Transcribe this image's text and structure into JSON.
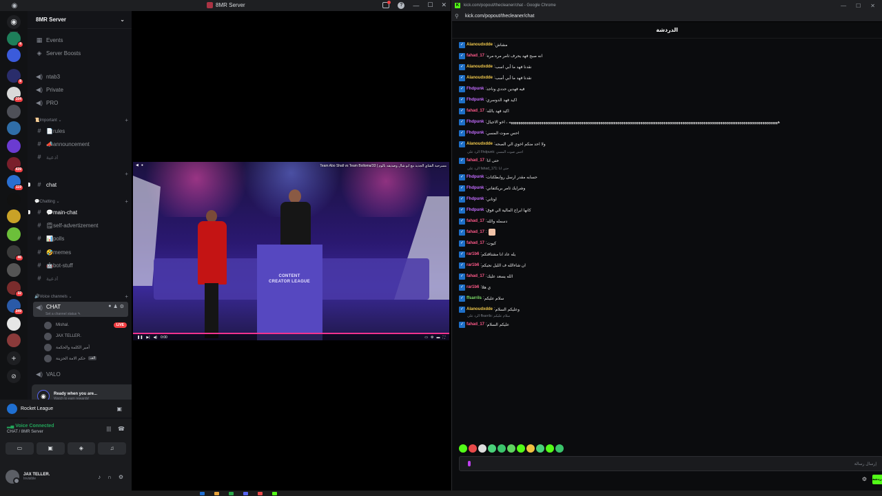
{
  "discord": {
    "window_title": "8MR Server",
    "server_name": "8MR Server",
    "channels": {
      "events": "Events",
      "boosts": "Server Boosts",
      "ntab3": "ntab3",
      "private": "Private",
      "pro": "PRO",
      "cat_important": "📜Important ⌄",
      "rules": "📄rules",
      "announcement": "📣announcement",
      "dim1": "ادعية",
      "chat": "chat",
      "cat_chatting": "💬Chatting ⌄",
      "main_chat": "💬main-chat",
      "self_ad": "🗒self-advertizement",
      "polls": "📊polls",
      "memes": "🤣memes",
      "bot_stuff": "🤖bot-stuff",
      "dim2": "ادعية",
      "cat_voice": "🔊Voice channels ⌄",
      "voice_chat": "CHAT",
      "voice_status": "Set a channel status ✎",
      "valo": "VALO"
    },
    "voice_users": [
      {
        "name": "Mishal.",
        "badge": "LIVE"
      },
      {
        "name": "JAX TELLER.",
        "badge": ""
      },
      {
        "name": "أمير الكلمة والحكمة",
        "badge": ""
      },
      {
        "name": "حكم الامة الحزينة",
        "badge": "الف"
      }
    ],
    "server_badges": [
      "",
      "4",
      "",
      "",
      "8",
      "104",
      "",
      "",
      "",
      "439",
      "119",
      "",
      "",
      "",
      "46",
      "",
      "32",
      "349",
      "",
      ""
    ],
    "quest": {
      "title": "Ready when you are...",
      "subtitle": "Watch to earn rewards!"
    },
    "activity": {
      "game": "Rocket League"
    },
    "voice_connected": {
      "status": "Voice Connected",
      "channel": "CHAT / 8MR Server"
    },
    "user": {
      "name": "JAX TELLER.",
      "status": "Invisible"
    }
  },
  "stream": {
    "overlay_title": "Team Abo Shall vs Team Bolloma/33 | مسرحية الشاي الجديد مع ابو شال وصديقه بالوم",
    "podium_logo": "CONTENT CREATOR LEAGUE",
    "controls_time": "0:00"
  },
  "browser": {
    "title": "kick.com/popout/thecleaner/chat - Google Chrome",
    "url": "kick.com/popout/thecleaner/chat",
    "chat_title": "الدردشة",
    "input_placeholder": "إرسال رسالة",
    "send_label": "دردشة"
  },
  "chat": {
    "messages": [
      {
        "user": "Alanoudxdde",
        "color": "#f2c94c",
        "text": "مشاش"
      },
      {
        "user": "fahad_17",
        "color": "#ff5a8a",
        "text": "انه صبح فهد يحرف ثامر مره مره"
      },
      {
        "user": "Alanoudxdde",
        "color": "#f2c94c",
        "text": "نقدنا فهد ما أبي اسب"
      },
      {
        "user": "Alanoudxdde",
        "color": "#f2c94c",
        "text": "نقدنا فهد ما أبي أسب"
      },
      {
        "user": "Fhdpunk",
        "color": "#c46cff",
        "text": "فيه فهدين حددي وناحد"
      },
      {
        "user": "Fhdpunk",
        "color": "#c46cff",
        "text": "اكيد فهد الدوسري"
      },
      {
        "user": "fahad_17",
        "color": "#ff5a8a",
        "text": "اكيد فهد بالله"
      },
      {
        "user": "Fhdpunk",
        "color": "#c46cff",
        "text": "هههههههههههههههههههههههههههههههههههههههههههههههههههههههههههههههههههههههههههههههههههههههههههههههههههههههههههههههههههههههههههههههههههههههههههههه ، اخو الاجيال"
      },
      {
        "user": "Fhdpunk",
        "color": "#c46cff",
        "text": "احس صوت المسي"
      },
      {
        "user": "Alanoudxdde",
        "color": "#f2c94c",
        "text": "ولا احد منكم اخوي الي الصحه"
      },
      {
        "user": "fahad_17",
        "color": "#ff5a8a",
        "text": "حتى انا"
      },
      {
        "user": "Fhdpunk",
        "color": "#c46cff",
        "text": "حسابه مقدر ارسل روابطكنات"
      },
      {
        "user": "Fhdpunk",
        "color": "#c46cff",
        "text": "وشرايك ثامر بريكتفاني"
      },
      {
        "user": "Fhdpunk",
        "color": "#c46cff",
        "text": "اوتاني"
      },
      {
        "user": "Fhdpunk",
        "color": "#c46cff",
        "text": "كانها ابراج المالية الي فوق"
      },
      {
        "user": "fahad_17",
        "color": "#ff5a8a",
        "text": "دسمله والله"
      },
      {
        "user": "fahad_17",
        "color": "#ff5a8a",
        "text": ""
      },
      {
        "user": "fahad_17",
        "color": "#ff5a8a",
        "text": "كيوت"
      },
      {
        "user": "rar1b6",
        "color": "#ff5a8a",
        "text": "يله عاد انا مشتاقتكم"
      },
      {
        "user": "rar1b6",
        "color": "#ff5a8a",
        "text": "ان شاءالله ف الليل نجيكم"
      },
      {
        "user": "fahad_17",
        "color": "#ff5a8a",
        "text": "الله يسعد عليك"
      },
      {
        "user": "rar1b6",
        "color": "#ff5a8a",
        "text": "ي هلا"
      },
      {
        "user": "ffsarrils",
        "color": "#7ee06a",
        "text": "سلام عليكم"
      },
      {
        "user": "Alanoudxdde",
        "color": "#f2c94c",
        "text": "وعليكم السلام"
      },
      {
        "user": "fahad_17",
        "color": "#ff5a8a",
        "text": "عليكم السلام"
      }
    ],
    "replies": [
      "الرد على Fhdpunk: احس صوت المسي",
      "الرد على fahad_171: حتى انا",
      "الرد على ffsarrils: سلام عليكم"
    ]
  },
  "colors": {
    "discord_bg": "#131418",
    "kick_green": "#53fc18",
    "live_red": "#f23f43",
    "voice_green": "#23a55a"
  }
}
